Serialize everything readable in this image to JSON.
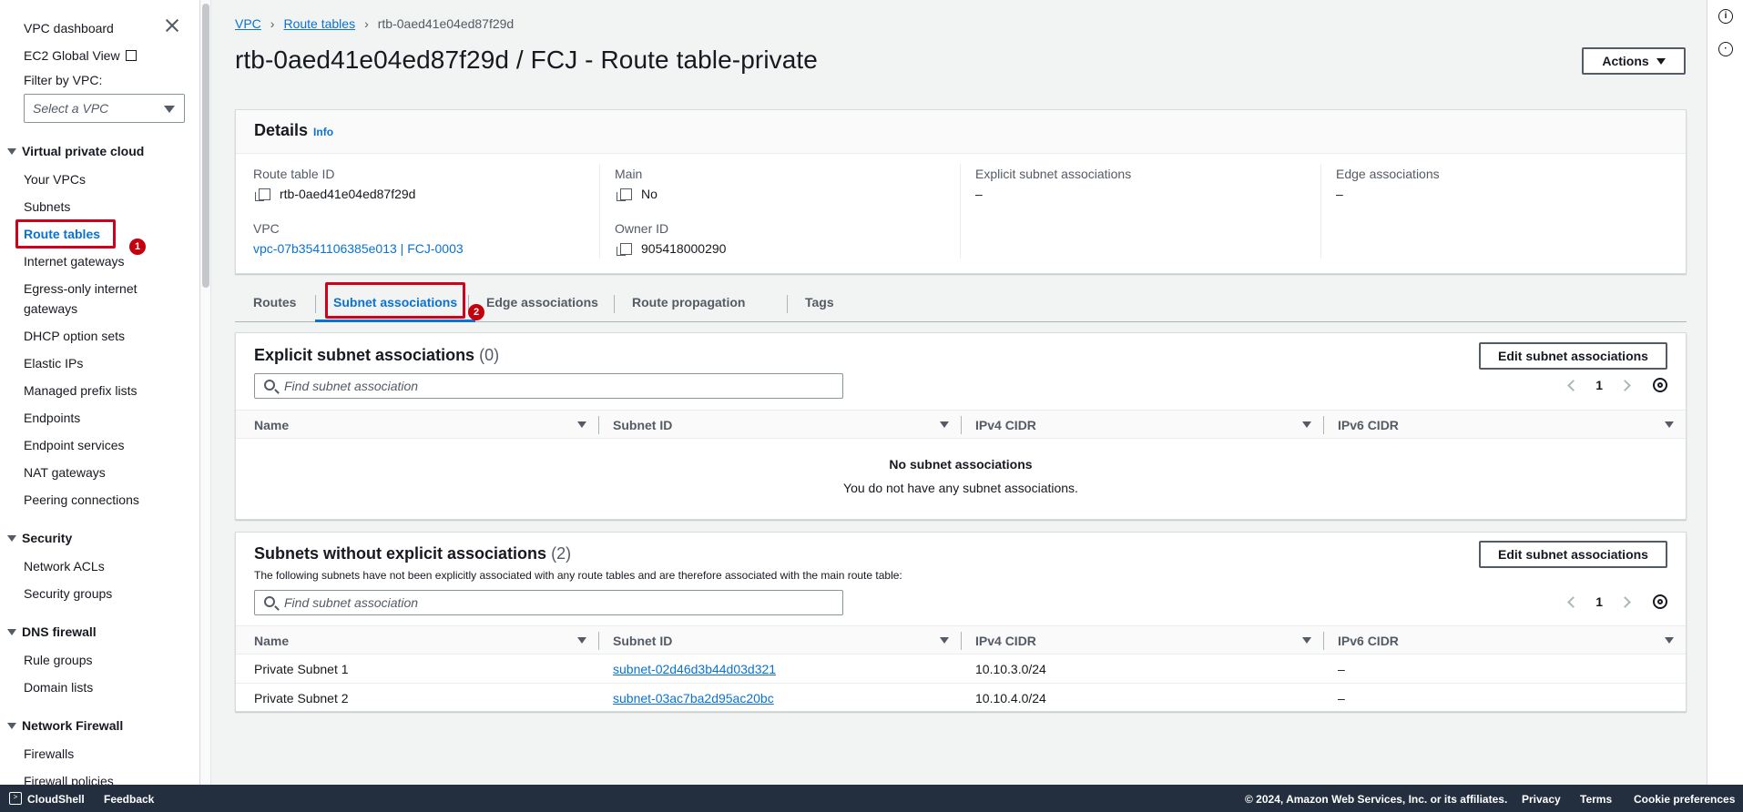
{
  "sidebar": {
    "top_links": [
      "VPC dashboard",
      "EC2 Global View"
    ],
    "filter_label": "Filter by VPC:",
    "filter_placeholder": "Select a VPC",
    "sections": [
      {
        "title": "Virtual private cloud",
        "items": [
          "Your VPCs",
          "Subnets",
          "Route tables",
          "Internet gateways",
          "Egress-only internet",
          "gateways",
          "DHCP option sets",
          "Elastic IPs",
          "Managed prefix lists",
          "Endpoints",
          "Endpoint services",
          "NAT gateways",
          "Peering connections"
        ]
      },
      {
        "title": "Security",
        "items": [
          "Network ACLs",
          "Security groups"
        ]
      },
      {
        "title": "DNS firewall",
        "items": [
          "Rule groups",
          "Domain lists"
        ]
      },
      {
        "title": "Network Firewall",
        "items": [
          "Firewalls",
          "Firewall policies"
        ]
      }
    ],
    "active_item": "Route tables"
  },
  "annotations": {
    "badge1": "1",
    "badge2": "2"
  },
  "breadcrumb": [
    "VPC",
    "Route tables",
    "rtb-0aed41e04ed87f29d"
  ],
  "page_title": "rtb-0aed41e04ed87f29d / FCJ - Route table-private",
  "actions_label": "Actions",
  "details": {
    "title": "Details",
    "info": "Info",
    "route_table_id_label": "Route table ID",
    "route_table_id": "rtb-0aed41e04ed87f29d",
    "vpc_label": "VPC",
    "vpc": "vpc-07b3541106385e013 | FCJ-0003",
    "main_label": "Main",
    "main": "No",
    "owner_label": "Owner ID",
    "owner": "905418000290",
    "explicit_label": "Explicit subnet associations",
    "explicit": "–",
    "edge_label": "Edge associations",
    "edge": "–"
  },
  "tabs": [
    "Routes",
    "Subnet associations",
    "Edge associations",
    "Route propagation",
    "Tags"
  ],
  "explicit_table": {
    "title": "Explicit subnet associations",
    "count": "(0)",
    "edit_label": "Edit subnet associations",
    "search_placeholder": "Find subnet association",
    "page": "1",
    "columns": [
      "Name",
      "Subnet ID",
      "IPv4 CIDR",
      "IPv6 CIDR"
    ],
    "empty_title": "No subnet associations",
    "empty_sub": "You do not have any subnet associations."
  },
  "implicit_table": {
    "title": "Subnets without explicit associations",
    "count": "(2)",
    "description": "The following subnets have not been explicitly associated with any route tables and are therefore associated with the main route table:",
    "edit_label": "Edit subnet associations",
    "search_placeholder": "Find subnet association",
    "page": "1",
    "columns": [
      "Name",
      "Subnet ID",
      "IPv4 CIDR",
      "IPv6 CIDR"
    ],
    "rows": [
      {
        "name": "Private Subnet 1",
        "subnet_id": "subnet-02d46d3b44d03d321",
        "ipv4": "10.10.3.0/24",
        "ipv6": "–"
      },
      {
        "name": "Private Subnet 2",
        "subnet_id": "subnet-03ac7ba2d95ac20bc",
        "ipv4": "10.10.4.0/24",
        "ipv6": "–"
      }
    ]
  },
  "footer": {
    "cloudshell": "CloudShell",
    "feedback": "Feedback",
    "copyright": "© 2024, Amazon Web Services, Inc. or its affiliates.",
    "privacy": "Privacy",
    "terms": "Terms",
    "cookies": "Cookie preferences"
  }
}
